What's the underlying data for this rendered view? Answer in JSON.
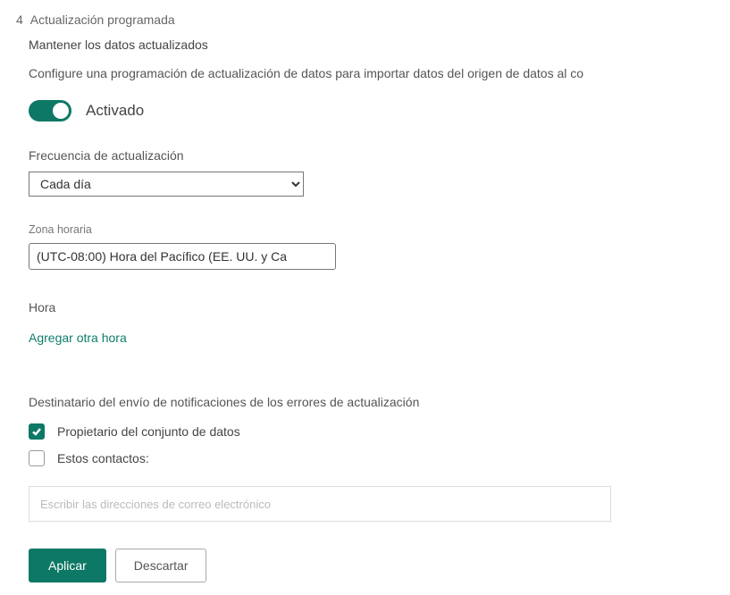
{
  "section": {
    "number": "4",
    "title": "Actualización programada"
  },
  "subtitle": "Mantener los datos actualizados",
  "description": "Configure una programación de actualización de datos para importar datos del origen de datos al co",
  "toggle": {
    "state_label": "Activado"
  },
  "frequency": {
    "label": "Frecuencia de actualización",
    "value": "Cada día"
  },
  "timezone": {
    "label": "Zona horaria",
    "value": "(UTC-08:00) Hora del Pacífico (EE. UU. y Ca"
  },
  "time": {
    "label": "Hora",
    "add_link": "Agregar otra hora"
  },
  "notifications": {
    "title": "Destinatario del envío de notificaciones de los errores de actualización",
    "owner_label": "Propietario del conjunto de datos",
    "contacts_label": "Estos contactos:",
    "email_placeholder": "Escribir las direcciones de correo electrónico"
  },
  "buttons": {
    "apply": "Aplicar",
    "discard": "Descartar"
  }
}
